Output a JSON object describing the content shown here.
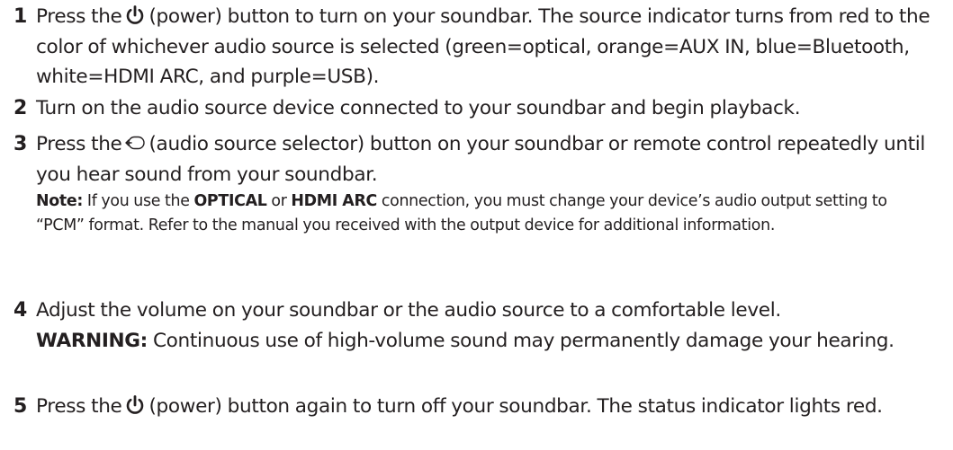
{
  "steps": [
    {
      "number": "1",
      "before": "Press the",
      "icon": "power-icon",
      "after": "(power) button to turn on your soundbar. The source indicator turns from red to the color of whichever audio source is selected (green=optical, orange=AUX IN, blue=Bluetooth, white=HDMI ARC, and purple=USB)."
    },
    {
      "number": "2",
      "text": "Turn on the audio source device connected to your soundbar and begin playback."
    },
    {
      "number": "3",
      "before": "Press the",
      "icon": "source-selector-icon",
      "after": "(audio source selector) button on your soundbar or remote control repeatedly until you hear sound from your soundbar.",
      "note": {
        "label": "Note:",
        "part1": "If you use the",
        "optical": "OPTICAL",
        "or": "or",
        "hdmi": "HDMI ARC",
        "part2": "connection, you must change your device’s audio output setting to “PCM” format. Refer to the manual you received with the output device for additional information."
      }
    },
    {
      "number": "4",
      "text": "Adjust the volume on your soundbar or the audio source to a comfortable level.",
      "warning": {
        "label": "WARNING:",
        "text": "Continuous use of high-volume sound may permanently damage your hearing."
      }
    },
    {
      "number": "5",
      "before": "Press the",
      "icon": "power-icon",
      "after": "(power) button again to turn off your soundbar. The status indicator lights red."
    }
  ]
}
